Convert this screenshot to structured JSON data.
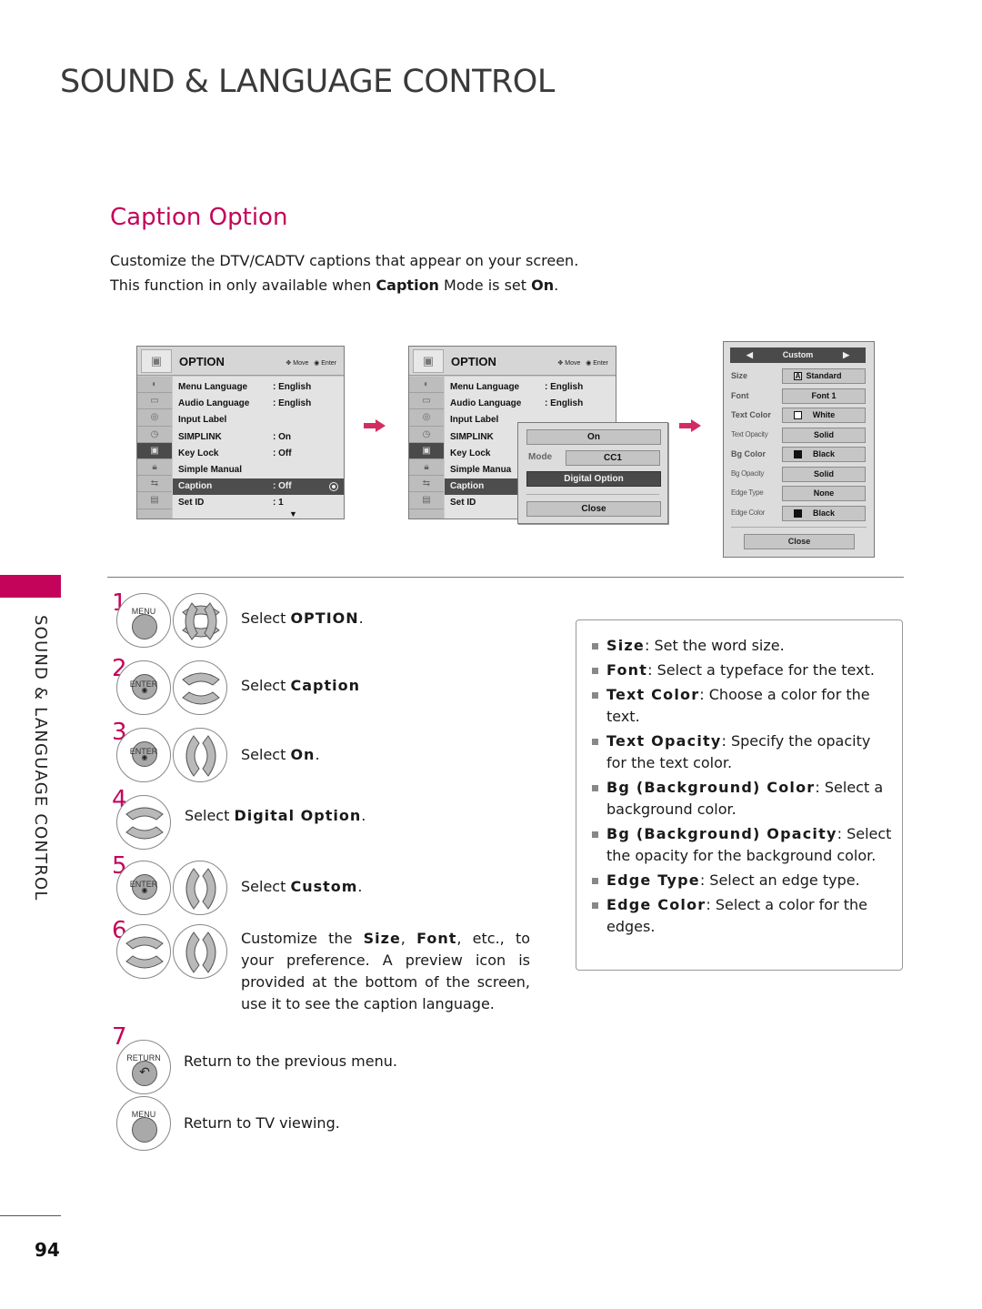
{
  "page": {
    "title": "SOUND & LANGUAGE CONTROL",
    "section_title": "Caption Option",
    "intro_line1": "Customize the DTV/CADTV captions that appear on your screen.",
    "intro_line2_pre": "This function in only available when ",
    "intro_line2_bold1": "Caption",
    "intro_line2_mid": " Mode is set ",
    "intro_line2_bold2": "On",
    "intro_line2_end": ".",
    "side_label": "SOUND & LANGUAGE CONTROL",
    "page_number": "94",
    "accent_color": "#c4045a"
  },
  "osd_menu_1": {
    "title": "OPTION",
    "hint_move": "Move",
    "hint_enter": "Enter",
    "rows": [
      {
        "label": "Menu Language",
        "value": ": English"
      },
      {
        "label": "Audio Language",
        "value": ": English"
      },
      {
        "label": "Input Label",
        "value": ""
      },
      {
        "label": "SIMPLINK",
        "value": ": On"
      },
      {
        "label": "Key Lock",
        "value": ": Off"
      },
      {
        "label": "Simple Manual",
        "value": ""
      },
      {
        "label": "Caption",
        "value": ": Off",
        "selected": true
      },
      {
        "label": "Set ID",
        "value": ": 1"
      }
    ],
    "sidebar_icons": [
      "picture-icon",
      "screen-icon",
      "audio-icon",
      "time-icon",
      "option-icon",
      "lock-icon",
      "input-icon",
      "usb-icon"
    ]
  },
  "osd_menu_2": {
    "title": "OPTION",
    "hint_move": "Move",
    "hint_enter": "Enter",
    "rows": [
      {
        "label": "Menu Language",
        "value": ": English"
      },
      {
        "label": "Audio Language",
        "value": ": English"
      },
      {
        "label": "Input Label",
        "value": ""
      },
      {
        "label": "SIMPLINK",
        "value": ""
      },
      {
        "label": "Key Lock",
        "value": ""
      },
      {
        "label": "Simple Manua",
        "value": ""
      },
      {
        "label": "Caption",
        "value": "",
        "selected": true
      },
      {
        "label": "Set ID",
        "value": ""
      }
    ],
    "popup": {
      "on_label": "On",
      "mode_label": "Mode",
      "mode_value": "CC1",
      "digital_option_label": "Digital Option",
      "close_label": "Close"
    }
  },
  "custom_panel": {
    "header": "Custom",
    "rows": [
      {
        "label": "Size",
        "value": "Standard",
        "swatch": "A"
      },
      {
        "label": "Font",
        "value": "Font 1",
        "swatch": ""
      },
      {
        "label": "Text Color",
        "value": "White",
        "swatch": "white"
      },
      {
        "label": "Text Opacity",
        "value": "Solid",
        "swatch": ""
      },
      {
        "label": "Bg Color",
        "value": "Black",
        "swatch": "black"
      },
      {
        "label": "Bg Opacity",
        "value": "Solid",
        "swatch": ""
      },
      {
        "label": "Edge Type",
        "value": "None",
        "swatch": ""
      },
      {
        "label": "Edge Color",
        "value": "Black",
        "swatch": "black"
      }
    ],
    "close_label": "Close"
  },
  "steps": [
    {
      "num": "1",
      "button": "MENU",
      "pre": "Select ",
      "bold": "OPTION",
      "post": "."
    },
    {
      "num": "2",
      "button": "ENTER",
      "pre": "Select ",
      "bold": "Caption",
      "post": ""
    },
    {
      "num": "3",
      "button": "ENTER",
      "pre": "Select ",
      "bold": "On",
      "post": "."
    },
    {
      "num": "4",
      "button": "",
      "pre": "Select ",
      "bold": "Digital Option",
      "post": "."
    },
    {
      "num": "5",
      "button": "ENTER",
      "pre": "Select ",
      "bold": "Custom",
      "post": "."
    },
    {
      "num": "6",
      "button": "",
      "pre": "Customize the ",
      "bold": "Size",
      "mid": ", ",
      "bold2": "Font",
      "post": ", etc., to your preference. A preview icon is provided at the bottom of the screen, use it to see the caption language."
    },
    {
      "num": "7",
      "button": "RETURN",
      "text": "Return to the previous menu."
    },
    {
      "num": "",
      "button": "MENU",
      "text": "Return to TV viewing."
    }
  ],
  "info_bullets": [
    {
      "term": "Size",
      "desc": ": Set the word size."
    },
    {
      "term": "Font",
      "desc": ": Select a typeface for the text."
    },
    {
      "term": "Text Color",
      "desc": ": Choose a color for the text."
    },
    {
      "term": "Text Opacity",
      "desc": ": Specify the opacity for the text color."
    },
    {
      "term": "Bg (Background) Color",
      "desc": ": Select a background color."
    },
    {
      "term": "Bg (Background) Opacity",
      "desc": ": Select the opacity for the background color."
    },
    {
      "term": "Edge Type",
      "desc": ": Select an edge type."
    },
    {
      "term": "Edge Color",
      "desc": ": Select a color for the edges."
    }
  ]
}
